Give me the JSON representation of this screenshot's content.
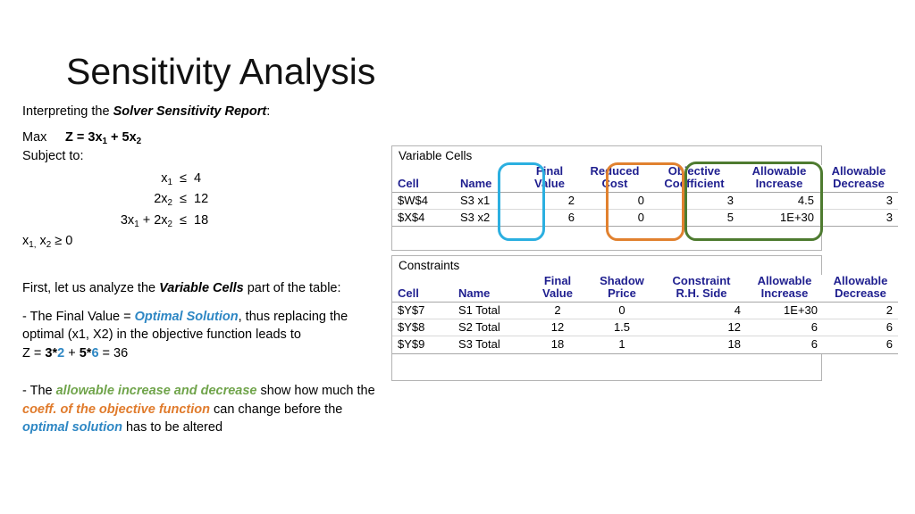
{
  "slide": {
    "title": "Sensitivity Analysis"
  },
  "intro": {
    "lead": "Interpreting the ",
    "emphasis": "Solver Sensitivity Report",
    "trail": ":"
  },
  "model": {
    "max_label": "Max",
    "objective_prefix": "Z = 3x",
    "objective_sub1": "1",
    "objective_mid": " + 5x",
    "objective_sub2": "2",
    "subject_to": "Subject to:",
    "constraints": [
      {
        "lhs_a": "x",
        "lhs_a_sub": "1",
        "lhs_b": "",
        "lhs_b_sub": "",
        "op": "≤",
        "rhs": "4"
      },
      {
        "lhs_a": "2x",
        "lhs_a_sub": "2",
        "lhs_b": "",
        "lhs_b_sub": "",
        "op": "≤",
        "rhs": "12"
      },
      {
        "lhs_a": "3x",
        "lhs_a_sub": "1",
        "lhs_b": " + 2x",
        "lhs_b_sub": "2",
        "op": "≤",
        "rhs": "18"
      }
    ],
    "nonneg_prefix": "x",
    "nonneg_sub1": "1,",
    "nonneg_mid": " x",
    "nonneg_sub2": "2",
    "nonneg_trail": " ≥ 0"
  },
  "notes": {
    "first_line_a": "First, let us analyze the ",
    "first_line_emph": "Variable Cells",
    "first_line_b": " part of the table:",
    "final_a": " - The Final Value = ",
    "final_emph": "Optimal Solution",
    "final_b": ", thus replacing the optimal (x1, X2) in the objective function leads to",
    "z_prefix": "Z = ",
    "z_c1": "3*",
    "z_v1": "2",
    "z_plus": " + ",
    "z_c2": "5*",
    "z_v2": "6",
    "z_result": " = 36",
    "allow_a": " - The ",
    "allow_emph_green": "allowable increase and decrease",
    "allow_b": " show how much the ",
    "allow_emph_orange": "coeff. of the objective function",
    "allow_c": " can change before the ",
    "allow_emph_blue": "optimal solution",
    "allow_d": " has to be altered"
  },
  "colors": {
    "header_navy": "#1F1F8F",
    "highlight_cyan": "#2BAFE0",
    "highlight_orange": "#E1812F",
    "highlight_green": "#4E7B30",
    "text_blue": "#2E87C4",
    "text_green": "#70A44B",
    "text_orange": "#E07B2C"
  },
  "variable_cells": {
    "caption": "Variable Cells",
    "headers": [
      {
        "l1": "",
        "l2": "Cell"
      },
      {
        "l1": "",
        "l2": "Name"
      },
      {
        "l1": "Final",
        "l2": "Value"
      },
      {
        "l1": "Reduced",
        "l2": "Cost"
      },
      {
        "l1": "Objective",
        "l2": "Coefficient"
      },
      {
        "l1": "Allowable",
        "l2": "Increase"
      },
      {
        "l1": "Allowable",
        "l2": "Decrease"
      }
    ],
    "rows": [
      {
        "cell": "$W$4",
        "name": "S3 x1",
        "final_value": "2",
        "reduced_cost": "0",
        "objective_coefficient": "3",
        "allowable_increase": "4.5",
        "allowable_decrease": "3"
      },
      {
        "cell": "$X$4",
        "name": "S3 x2",
        "final_value": "6",
        "reduced_cost": "0",
        "objective_coefficient": "5",
        "allowable_increase": "1E+30",
        "allowable_decrease": "3"
      }
    ]
  },
  "constraints_table": {
    "caption": "Constraints",
    "headers": [
      {
        "l1": "",
        "l2": "Cell"
      },
      {
        "l1": "",
        "l2": "Name"
      },
      {
        "l1": "Final",
        "l2": "Value"
      },
      {
        "l1": "Shadow",
        "l2": "Price"
      },
      {
        "l1": "Constraint",
        "l2": "R.H. Side"
      },
      {
        "l1": "Allowable",
        "l2": "Increase"
      },
      {
        "l1": "Allowable",
        "l2": "Decrease"
      }
    ],
    "rows": [
      {
        "cell": "$Y$7",
        "name": "S1 Total",
        "final_value": "2",
        "shadow_price": "0",
        "rhs": "4",
        "allowable_increase": "1E+30",
        "allowable_decrease": "2"
      },
      {
        "cell": "$Y$8",
        "name": "S2 Total",
        "final_value": "12",
        "shadow_price": "1.5",
        "rhs": "12",
        "allowable_increase": "6",
        "allowable_decrease": "6"
      },
      {
        "cell": "$Y$9",
        "name": "S3 Total",
        "final_value": "18",
        "shadow_price": "1",
        "rhs": "18",
        "allowable_increase": "6",
        "allowable_decrease": "6"
      }
    ]
  }
}
